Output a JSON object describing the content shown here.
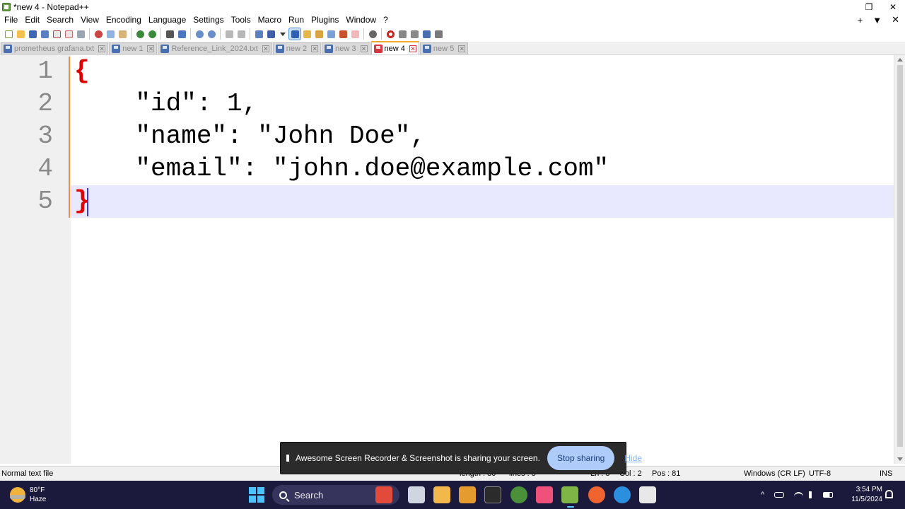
{
  "window": {
    "title": "*new 4 - Notepad++",
    "restore_glyph": "❐",
    "close_glyph": "✕"
  },
  "menu": {
    "items": [
      "File",
      "Edit",
      "Search",
      "View",
      "Encoding",
      "Language",
      "Settings",
      "Tools",
      "Macro",
      "Run",
      "Plugins",
      "Window",
      "?"
    ],
    "plus_glyph": "+",
    "dropdown_glyph": "▼",
    "close_glyph": "✕"
  },
  "tabs": [
    {
      "label": "prometheus grafana.txt",
      "active": false
    },
    {
      "label": "new 1",
      "active": false
    },
    {
      "label": "Reference_Link_2024.txt",
      "active": false
    },
    {
      "label": "new 2",
      "active": false
    },
    {
      "label": "new 3",
      "active": false
    },
    {
      "label": "new 4",
      "active": true
    },
    {
      "label": "new 5",
      "active": false
    }
  ],
  "tab_close_glyph": "✕",
  "editor": {
    "line_numbers": [
      "1",
      "2",
      "3",
      "4",
      "5"
    ],
    "lines": [
      "{",
      "    \"id\": 1,",
      "    \"name\": \"John Doe\",",
      "    \"email\": \"john.doe@example.com\"",
      "}"
    ],
    "current_line": 5
  },
  "status": {
    "file_type": "Normal text file",
    "length": "length : 80",
    "lines": "lines : 5",
    "ln": "Ln : 5",
    "col": "Col : 2",
    "pos": "Pos : 81",
    "eol": "Windows (CR LF)",
    "encoding": "UTF-8",
    "mode": "INS"
  },
  "share_popup": {
    "message": "Awesome Screen Recorder & Screenshot is sharing your screen.",
    "stop_label": "Stop sharing",
    "hide_label": "Hide"
  },
  "taskbar": {
    "weather_temp": "80°F",
    "weather_desc": "Haze",
    "search_label": "Search",
    "tray_chevron": "^",
    "time": "3:54 PM",
    "date": "11/5/2024"
  },
  "colors": {
    "brace": "#e00000",
    "current_line_bg": "#e8e8ff",
    "gutter_bg": "#f0f0f0",
    "fold_margin": "#f28f3b",
    "active_tab_accent": "#f5a623",
    "taskbar_bg": "#1c1a3c"
  }
}
